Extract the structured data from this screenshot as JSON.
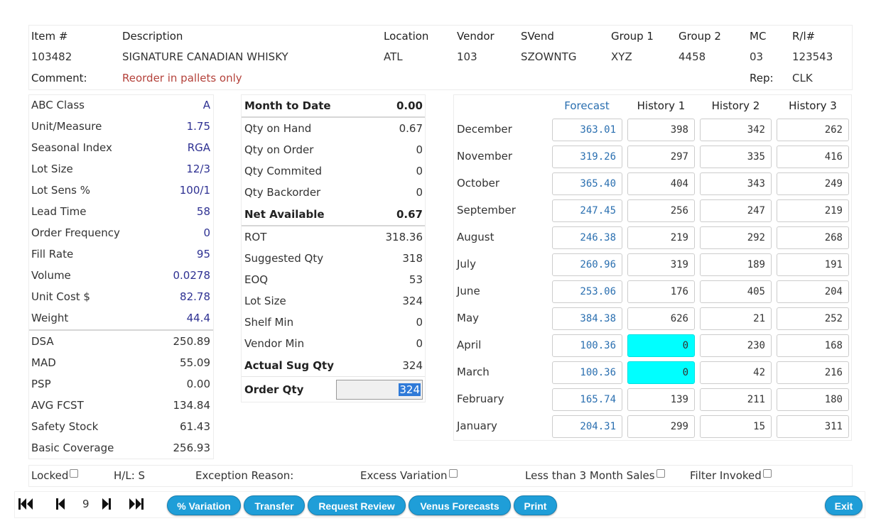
{
  "header": {
    "cols": {
      "item": "Item #",
      "description": "Description",
      "location": "Location",
      "vendor": "Vendor",
      "svend": "SVend",
      "group1": "Group 1",
      "group2": "Group 2",
      "mc": "MC",
      "rl": "R/l#"
    },
    "values": {
      "item": "103482",
      "description": "SIGNATURE CANADIAN WHISKY",
      "location": "ATL",
      "vendor": "103",
      "svend": "SZOWNTG",
      "group1": "XYZ",
      "group2": "4458",
      "mc": "03",
      "rl": "123543"
    },
    "comment_label": "Comment:",
    "comment_value": "Reorder in pallets only",
    "rep_label": "Rep:",
    "rep_value": "CLK"
  },
  "left_panel": {
    "top_rows": [
      {
        "label": "ABC Class",
        "value": "A"
      },
      {
        "label": "Unit/Measure",
        "value": "1.75"
      },
      {
        "label": "Seasonal Index",
        "value": "RGA"
      },
      {
        "label": "Lot Size",
        "value": "12/3"
      },
      {
        "label": "Lot Sens %",
        "value": "100/1"
      },
      {
        "label": "Lead Time",
        "value": "58"
      },
      {
        "label": "Order Frequency",
        "value": "0"
      },
      {
        "label": "Fill Rate",
        "value": "95"
      },
      {
        "label": "Volume",
        "value": "0.0278"
      },
      {
        "label": "Unit Cost $",
        "value": "82.78"
      },
      {
        "label": "Weight",
        "value": "44.4"
      }
    ],
    "bottom_rows": [
      {
        "label": "DSA",
        "value": "250.89"
      },
      {
        "label": "MAD",
        "value": "55.09"
      },
      {
        "label": "PSP",
        "value": "0.00"
      },
      {
        "label": "AVG FCST",
        "value": "134.84"
      },
      {
        "label": "Safety Stock",
        "value": "61.43"
      },
      {
        "label": "Basic Coverage",
        "value": "256.93"
      }
    ]
  },
  "mid_panel": {
    "month_to_date": {
      "label": "Month to Date",
      "value": "0.00"
    },
    "qty_rows": [
      {
        "label": "Qty on Hand",
        "value": "0.67"
      },
      {
        "label": "Qty on Order",
        "value": "0"
      },
      {
        "label": "Qty Commited",
        "value": "0"
      },
      {
        "label": "Qty Backorder",
        "value": "0"
      }
    ],
    "net_available": {
      "label": "Net Available",
      "value": "0.67"
    },
    "calc_rows": [
      {
        "label": "ROT",
        "value": "318.36"
      },
      {
        "label": "Suggested Qty",
        "value": "318"
      },
      {
        "label": "EOQ",
        "value": "53"
      },
      {
        "label": "Lot Size",
        "value": "324"
      },
      {
        "label": "Shelf Min",
        "value": "0"
      },
      {
        "label": "Vendor Min",
        "value": "0"
      }
    ],
    "actual_sug_qty": {
      "label": "Actual Sug Qty",
      "value": "324"
    },
    "order_qty": {
      "label": "Order Qty",
      "value": "324"
    }
  },
  "history": {
    "headers": {
      "forecast": "Forecast",
      "h1": "History 1",
      "h2": "History 2",
      "h3": "History 3"
    },
    "rows": [
      {
        "month": "December",
        "forecast": "363.01",
        "h1": "398",
        "h2": "342",
        "h3": "262"
      },
      {
        "month": "November",
        "forecast": "319.26",
        "h1": "297",
        "h2": "335",
        "h3": "416"
      },
      {
        "month": "October",
        "forecast": "365.40",
        "h1": "404",
        "h2": "343",
        "h3": "249"
      },
      {
        "month": "September",
        "forecast": "247.45",
        "h1": "256",
        "h2": "247",
        "h3": "219"
      },
      {
        "month": "August",
        "forecast": "246.38",
        "h1": "219",
        "h2": "292",
        "h3": "268"
      },
      {
        "month": "July",
        "forecast": "260.96",
        "h1": "319",
        "h2": "189",
        "h3": "191"
      },
      {
        "month": "June",
        "forecast": "253.06",
        "h1": "176",
        "h2": "405",
        "h3": "204"
      },
      {
        "month": "May",
        "forecast": "384.38",
        "h1": "626",
        "h2": "21",
        "h3": "252"
      },
      {
        "month": "April",
        "forecast": "100.36",
        "h1": "0",
        "h2": "230",
        "h3": "168"
      },
      {
        "month": "March",
        "forecast": "100.36",
        "h1": "0",
        "h2": "42",
        "h3": "216"
      },
      {
        "month": "February",
        "forecast": "165.74",
        "h1": "139",
        "h2": "211",
        "h3": "180"
      },
      {
        "month": "January",
        "forecast": "204.31",
        "h1": "299",
        "h2": "15",
        "h3": "311"
      }
    ],
    "highlight_color": "#00ffff"
  },
  "status_bar": {
    "locked": "Locked",
    "hl": "H/L: S",
    "exception_reason": "Exception Reason:",
    "excess_variation": "Excess Variation",
    "less_than_3": "Less than 3 Month Sales",
    "filter_invoked": "Filter Invoked"
  },
  "toolbar": {
    "page_number": "9",
    "buttons": {
      "variation": "% Variation",
      "transfer": "Transfer",
      "request_review": "Request Review",
      "venus_forecasts": "Venus Forecasts",
      "print": "Print",
      "exit": "Exit"
    },
    "button_color": "#1f9ed8"
  }
}
